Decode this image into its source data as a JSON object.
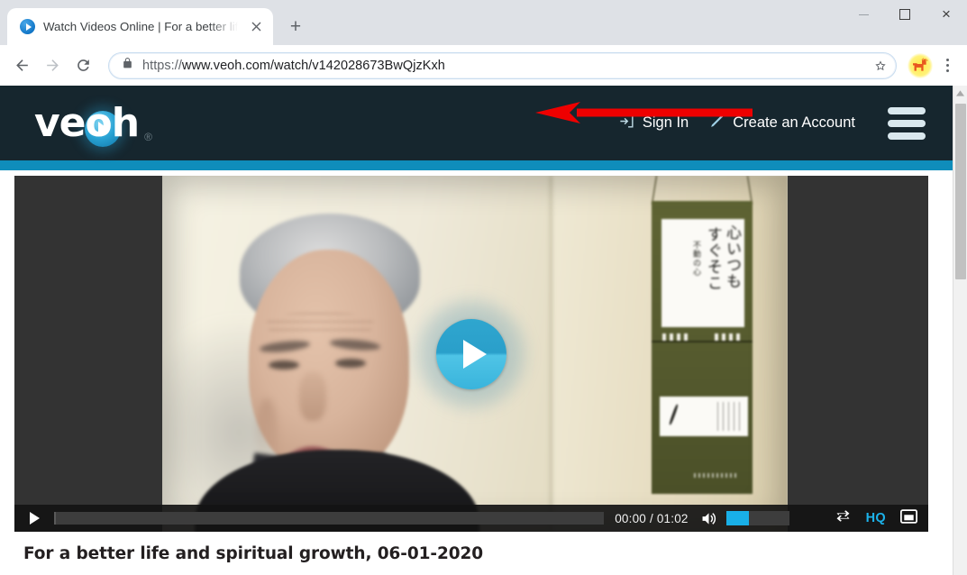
{
  "browser": {
    "tab": {
      "title": "Watch Videos Online | For a better life and spiritual growth",
      "favicon_icon": "play-circle-favicon",
      "close_icon": "close-icon"
    },
    "new_tab_label": "+",
    "window_controls": {
      "minimize_icon": "minimize-icon",
      "maximize_icon": "maximize-icon",
      "close_icon": "close-icon",
      "close_glyph": "×"
    },
    "toolbar": {
      "back_icon": "back-arrow-icon",
      "forward_icon": "forward-arrow-icon",
      "reload_icon": "reload-icon",
      "back_glyph": "←",
      "forward_glyph": "→",
      "lock_icon": "lock-icon",
      "bookmark_icon": "star-icon",
      "bookmark_glyph": "☆",
      "extension_icon": "extension-dog-icon",
      "menu_icon": "three-dot-menu-icon"
    },
    "omnibox": {
      "url_scheme": "https://",
      "url_rest": "www.veoh.com/watch/v142028673BwQjzKxh",
      "url_full": "https://www.veoh.com/watch/v142028673BwQjzKxh"
    },
    "annotation": {
      "arrow_icon": "red-left-arrow-annotation",
      "color": "#ee0000"
    },
    "scrollbar": {
      "up_arrow_icon": "scroll-up-arrow-icon",
      "thumb_name": "scrollbar-thumb"
    }
  },
  "site": {
    "brand": {
      "name": "veoh",
      "registered_mark": "®",
      "logo_icon": "veoh-play-logo-icon"
    },
    "nav": {
      "sign_in": {
        "label": "Sign In",
        "icon": "sign-in-icon"
      },
      "create_account": {
        "label": "Create an Account",
        "icon": "pencil-icon"
      },
      "menu_icon": "hamburger-menu-icon"
    },
    "colors": {
      "header_bg": "#16262e",
      "accent_bar": "#0f8dbb",
      "player_bg": "#333333",
      "control_bg": "#141414",
      "cyan_accent": "#1cb3eb"
    }
  },
  "player": {
    "play_overlay_icon": "big-play-button-icon",
    "controls": {
      "play_icon": "play-icon",
      "progress_name": "seek-bar",
      "time_display": "00:00 / 01:02",
      "current_time": "00:00",
      "duration": "01:02",
      "volume_icon": "volume-on-icon",
      "volume_bar_name": "volume-slider",
      "volume_level_percent": 36,
      "repeat_icon": "repeat-loop-icon",
      "quality_label": "HQ",
      "popout_icon": "popout-screen-icon"
    },
    "frame": {
      "scroll_calligraphy_line1": "心いつも",
      "scroll_calligraphy_line2": "すぐそこ",
      "scroll_calligraphy_line3": "不動の心"
    }
  },
  "video": {
    "title": "For a better life and spiritual growth, 06-01-2020"
  }
}
